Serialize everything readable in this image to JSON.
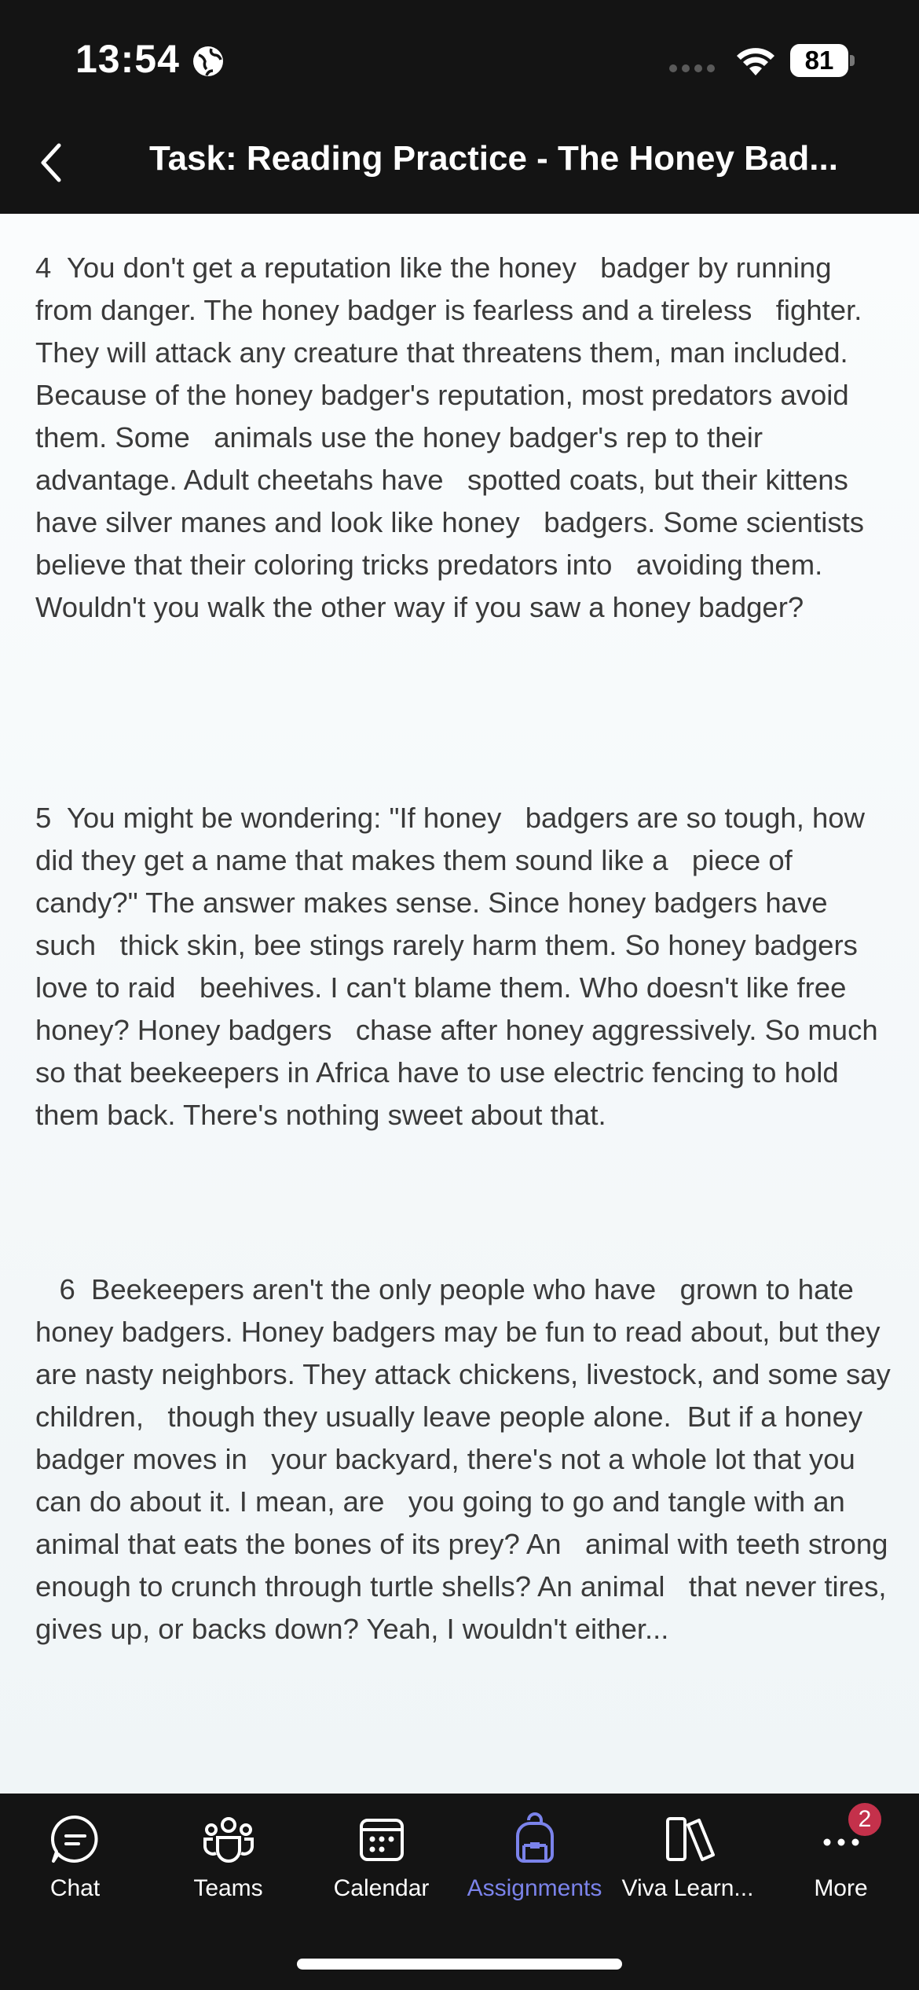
{
  "status_bar": {
    "time": "13:54",
    "battery": "81"
  },
  "header": {
    "title": "Task: Reading Practice - The Honey Bad..."
  },
  "content": {
    "paragraphs": [
      "4  You don't get a reputation like the honey   badger by running from danger. The honey badger is fearless and a tireless   fighter. They will attack any creature that threatens them, man included.   Because of the honey badger's reputation, most predators avoid them. Some   animals use the honey badger's rep to their advantage. Adult cheetahs have   spotted coats, but their kittens have silver manes and look like honey   badgers. Some scientists believe that their coloring tricks predators into   avoiding them. Wouldn't you walk the other way if you saw a honey badger?",
      "5  You might be wondering: \"If honey   badgers are so tough, how did they get a name that makes them sound like a   piece of candy?\" The answer makes sense. Since honey badgers have such   thick skin, bee stings rarely harm them. So honey badgers love to raid   beehives. I can't blame them. Who doesn't like free honey? Honey badgers   chase after honey aggressively. So much so that beekeepers in Africa have to use electric fencing to hold them back. There's nothing sweet about that.",
      "   6  Beekeepers aren't the only people who have   grown to hate honey badgers. Honey badgers may be fun to read about, but they   are nasty neighbors. They attack chickens, livestock, and some say children,   though they usually leave people alone.  But if a honey badger moves in   your backyard, there's not a whole lot that you can do about it. I mean, are   you going to go and tangle with an animal that eats the bones of its prey? An   animal with teeth strong enough to crunch through turtle shells? An animal   that never tires, gives up, or backs down? Yeah, I wouldn't either..."
    ]
  },
  "tab_bar": {
    "tabs": [
      {
        "label": "Chat",
        "icon": "chat-icon"
      },
      {
        "label": "Teams",
        "icon": "teams-icon"
      },
      {
        "label": "Calendar",
        "icon": "calendar-icon"
      },
      {
        "label": "Assignments",
        "icon": "backpack-icon",
        "active": true
      },
      {
        "label": "Viva Learn...",
        "icon": "books-icon"
      },
      {
        "label": "More",
        "icon": "more-icon"
      }
    ],
    "more_badge": "2"
  },
  "colors": {
    "accent": "#7b83eb",
    "badge": "#c4314b",
    "bar_bg": "#141414"
  }
}
